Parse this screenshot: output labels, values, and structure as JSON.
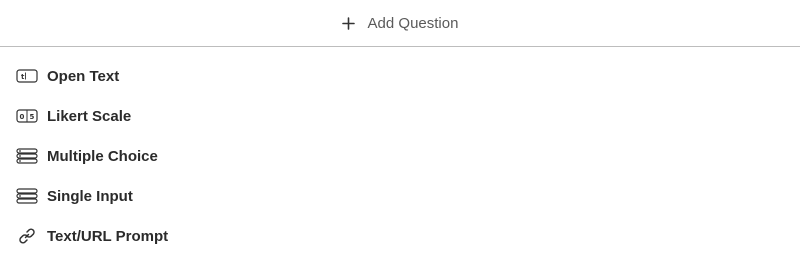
{
  "header": {
    "add_question_label": "Add Question",
    "add_icon": "plus-icon"
  },
  "menu": {
    "items": [
      {
        "label": "Open Text",
        "icon": "open-text-icon"
      },
      {
        "label": "Likert Scale",
        "icon": "likert-scale-icon"
      },
      {
        "label": "Multiple Choice",
        "icon": "multiple-choice-icon"
      },
      {
        "label": "Single Input",
        "icon": "single-input-icon"
      },
      {
        "label": "Text/URL Prompt",
        "icon": "link-icon"
      }
    ]
  },
  "colors": {
    "text": "#2b2b2b",
    "muted_text": "#5a5a5a",
    "divider": "#bdbdbd",
    "background": "#ffffff"
  }
}
